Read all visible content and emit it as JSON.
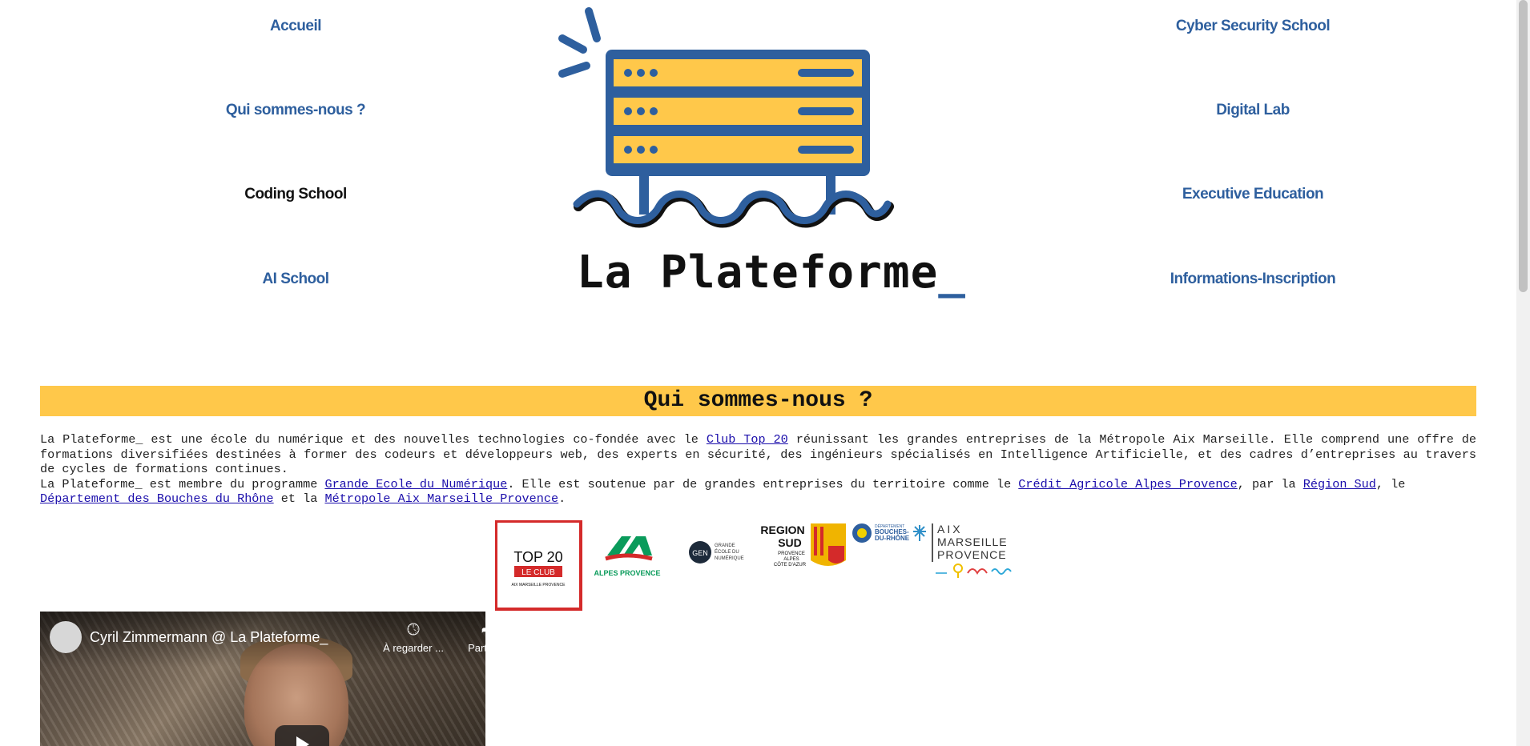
{
  "nav_left": [
    {
      "label": "Accueil",
      "active": false
    },
    {
      "label": "Qui sommes-nous ?",
      "active": false
    },
    {
      "label": "Coding School",
      "active": true
    },
    {
      "label": "AI School",
      "active": false
    }
  ],
  "nav_right": [
    {
      "label": "Cyber Security School"
    },
    {
      "label": "Digital Lab"
    },
    {
      "label": "Executive Education"
    },
    {
      "label": "Informations-Inscription"
    }
  ],
  "logo": {
    "title": "La Plateforme",
    "cursor": "_",
    "icon": "server-rack-icon"
  },
  "section": {
    "title": "Qui sommes-nous ?",
    "p1_text1": "La Plateforme_ est une école du numérique et des nouvelles technologies co-fondée avec le ",
    "p1_link1": "Club Top 20",
    "p1_text2": " réunissant les grandes entreprises de la Métropole Aix Marseille. Elle comprend une offre de formations diversifiées destinées à former des codeurs et développeurs web, des experts en sécurité, des ingénieurs spécialisés en Intelligence Artificielle, et des cadres d’entreprises au travers de cycles de formations continues.",
    "p2_text1": "La Plateforme_ est membre du programme ",
    "p2_link1": "Grande Ecole du Numérique",
    "p2_text2": ". Elle est soutenue par de grandes entreprises du territoire comme le ",
    "p2_link2": "Crédit Agricole Alpes Provence",
    "p2_text3": ", par la ",
    "p2_link3": "Région Sud",
    "p2_text4": ", le ",
    "p2_link4": "Département des Bouches du Rhône",
    "p2_text5": " et la ",
    "p2_link5": "Métropole Aix Marseille Provence",
    "p2_text6": "."
  },
  "partners": {
    "top20": {
      "line1": "TOP 20",
      "line2": "LE CLUB",
      "line3": "AIX MARSEILLE PROVENCE"
    },
    "ca": {
      "name": "ALPES PROVENCE"
    },
    "gen": {
      "abbr": "GEN",
      "line1": "GRANDE",
      "line2": "ÉCOLE DU",
      "line3": "NUMÉRIQUE"
    },
    "region": {
      "line1": "REGION",
      "line2": "SUD",
      "line3": "PROVENCE",
      "line4": "ALPES",
      "line5": "CÔTE D'AZUR"
    },
    "departement": {
      "line1": "DÉPARTEMENT",
      "line2": "BOUCHES-",
      "line3": "DU-RHÔNE"
    },
    "metropole": {
      "line1": "AIX",
      "line2": "MARSEILLE",
      "line3": "PROVENCE"
    }
  },
  "video": {
    "title": "Cyril Zimmermann @ La Plateforme_",
    "watch_later": "À regarder ...",
    "share": "Partager"
  },
  "colors": {
    "brand_blue": "#2e5f9e",
    "brand_yellow": "#ffc84a"
  }
}
